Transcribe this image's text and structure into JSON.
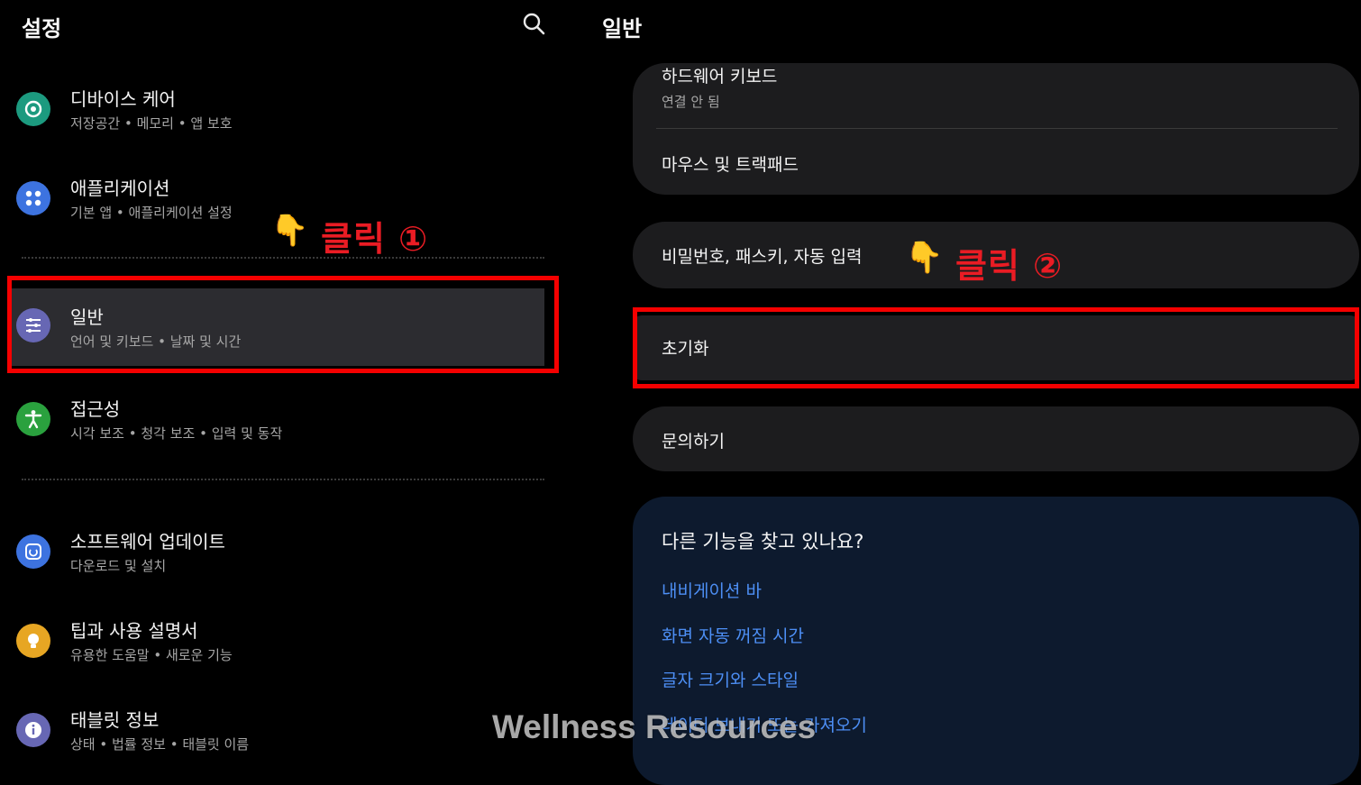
{
  "left": {
    "title": "설정",
    "items": [
      {
        "title": "디바이스 케어",
        "subtitle": "저장공간 • 메모리 • 앱 보호",
        "icon": "device-care-icon",
        "color": "#1c9a7f"
      },
      {
        "title": "애플리케이션",
        "subtitle": "기본 앱 • 애플리케이션 설정",
        "icon": "apps-icon",
        "color": "#3d73e0"
      },
      {
        "title": "일반",
        "subtitle": "언어 및 키보드 • 날짜 및 시간",
        "icon": "sliders-icon",
        "color": "#6767b4"
      },
      {
        "title": "접근성",
        "subtitle": "시각 보조 • 청각 보조 • 입력 및 동작",
        "icon": "accessibility-icon",
        "color": "#2aa13e"
      },
      {
        "title": "소프트웨어 업데이트",
        "subtitle": "다운로드 및 설치",
        "icon": "software-update-icon",
        "color": "#3d73e0"
      },
      {
        "title": "팁과 사용 설명서",
        "subtitle": "유용한 도움말 • 새로운 기능",
        "icon": "lightbulb-icon",
        "color": "#e7a623"
      },
      {
        "title": "태블릿 정보",
        "subtitle": "상태 • 법률 정보 • 태블릿 이름",
        "icon": "info-icon",
        "color": "#6767b4"
      }
    ]
  },
  "annotations": {
    "click1": "클릭 ①",
    "click2": "클릭 ②",
    "hand_glyph": "👇",
    "highlight_color": "#f50000"
  },
  "right": {
    "title": "일반",
    "keyboard": {
      "title": "하드웨어 키보드",
      "subtitle": "연결 안 됨"
    },
    "mouse": "마우스 및 트랙패드",
    "passwords": "비밀번호, 패스키, 자동 입력",
    "reset": "초기화",
    "contact": "문의하기",
    "suggest": {
      "heading": "다른 기능을 찾고 있나요?",
      "links": [
        "내비게이션 바",
        "화면 자동 꺼짐 시간",
        "글자 크기와 스타일",
        "데이터 보내기 또는 가져오기"
      ]
    }
  },
  "watermark": "Wellness Resources"
}
